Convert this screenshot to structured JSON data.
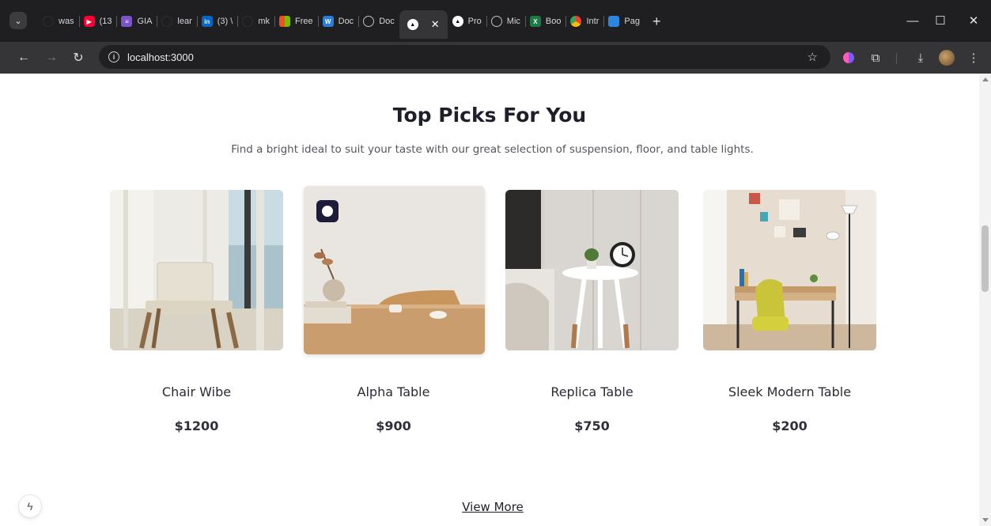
{
  "browser": {
    "tabs": [
      {
        "title": "was",
        "favicon": "github-icon"
      },
      {
        "title": "(13",
        "favicon": "youtube-icon"
      },
      {
        "title": "GIA",
        "favicon": "gia-icon"
      },
      {
        "title": "lear",
        "favicon": "github-icon"
      },
      {
        "title": "(3) \\",
        "favicon": "linkedin-icon"
      },
      {
        "title": "mk",
        "favicon": "github-icon"
      },
      {
        "title": "Free",
        "favicon": "microsoft-icon"
      },
      {
        "title": "Doc",
        "favicon": "word-icon"
      },
      {
        "title": "Doc",
        "favicon": "globe-icon"
      },
      {
        "title": "",
        "favicon": "vercel-icon",
        "active": true
      },
      {
        "title": "Pro",
        "favicon": "vercel-icon"
      },
      {
        "title": "Mic",
        "favicon": "globe-icon"
      },
      {
        "title": "Boo",
        "favicon": "excel-icon"
      },
      {
        "title": "Intr",
        "favicon": "chrome-icon"
      },
      {
        "title": "Pag",
        "favicon": "cloud-icon"
      }
    ],
    "new_tab_label": "+",
    "close_label": "✕",
    "url": "localhost:3000"
  },
  "page": {
    "section_title": "Top Picks For You",
    "section_subtitle": "Find a bright ideal to suit your taste with our great selection of suspension, floor, and table lights.",
    "products": [
      {
        "name": "Chair Wibe",
        "price": "$1200"
      },
      {
        "name": "Alpha Table",
        "price": "$900"
      },
      {
        "name": "Replica Table",
        "price": "$750"
      },
      {
        "name": "Sleek Modern Table",
        "price": "$200"
      }
    ],
    "view_more_label": "View More"
  }
}
